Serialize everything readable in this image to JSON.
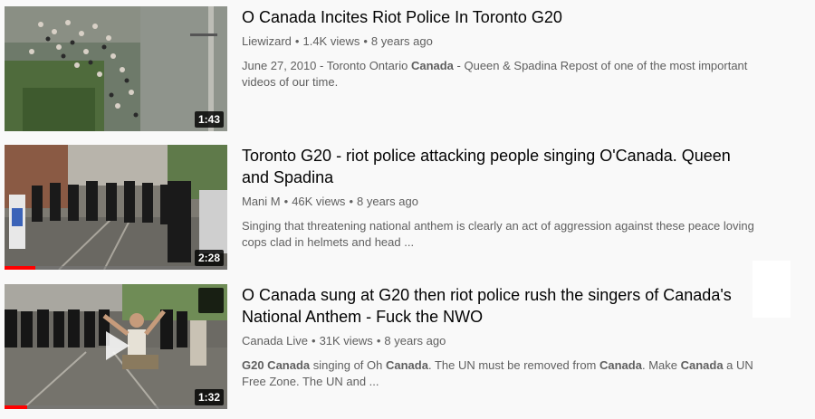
{
  "results": [
    {
      "title": "O Canada Incites Riot Police In Toronto G20",
      "channel": "Liewizard",
      "views": "1.4K views",
      "age": "8 years ago",
      "duration": "1:43",
      "description": [
        {
          "text": "June 27, 2010 - Toronto Ontario ",
          "bold": false
        },
        {
          "text": "Canada",
          "bold": true
        },
        {
          "text": " - Queen & Spadina Repost of one of the most important videos of our time.",
          "bold": false
        }
      ],
      "watched_fraction": 0
    },
    {
      "title": "Toronto G20 - riot police attacking people singing O'Canada. Queen and Spadina",
      "channel": "Mani M",
      "views": "46K views",
      "age": "8 years ago",
      "duration": "2:28",
      "description": [
        {
          "text": "Singing that threatening national anthem is clearly an act of aggression against these peace loving cops clad in helmets and head ...",
          "bold": false
        }
      ],
      "watched_fraction": 0.14
    },
    {
      "title": "O Canada sung at G20 then riot police rush the singers of Canada's National Anthem - Fuck the NWO",
      "channel": "Canada Live",
      "views": "31K views",
      "age": "8 years ago",
      "duration": "1:32",
      "description": [
        {
          "text": "G20 Canada",
          "bold": true
        },
        {
          "text": " singing of Oh ",
          "bold": false
        },
        {
          "text": "Canada",
          "bold": true
        },
        {
          "text": ". The UN must be removed from ",
          "bold": false
        },
        {
          "text": "Canada",
          "bold": true
        },
        {
          "text": ". Make ",
          "bold": false
        },
        {
          "text": "Canada",
          "bold": true
        },
        {
          "text": " a UN Free Zone. The UN and ...",
          "bold": false
        }
      ],
      "watched_fraction": 0.1
    }
  ],
  "colors": {
    "background": "#f9f9f9",
    "title": "#030303",
    "meta": "#606060",
    "progress": "#ff0000"
  },
  "icons": {
    "watch_later": "clock-icon",
    "play": "play-icon"
  }
}
